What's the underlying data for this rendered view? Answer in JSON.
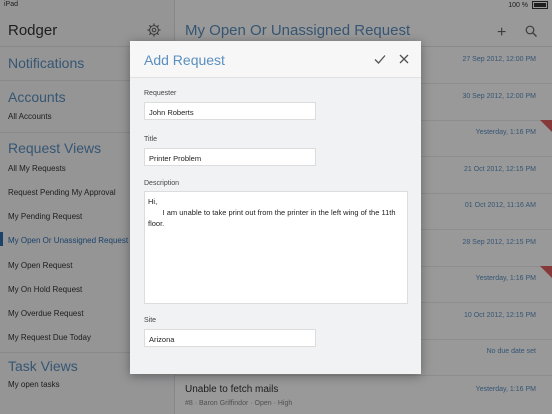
{
  "status_bar": {
    "device": "iPad",
    "battery": "100 %"
  },
  "sidebar": {
    "user_name": "Rodger",
    "notifications": "Notifications",
    "accounts": {
      "title": "Accounts",
      "items": [
        "All Accounts"
      ]
    },
    "request_views": {
      "title": "Request Views",
      "items": [
        "All My Requests",
        "Request Pending My Approval",
        "My Pending Request",
        "My Open Or Unassigned Request",
        "My Open Request",
        "My On Hold Request",
        "My Overdue Request",
        "My Request Due Today"
      ],
      "active": "My Open Or Unassigned Request"
    },
    "task_views": {
      "title": "Task Views",
      "items": [
        "My open tasks"
      ]
    }
  },
  "main": {
    "title": "My Open Or Unassigned Request",
    "rows": [
      {
        "date": "27 Sep 2012, 12:00 PM",
        "flag": false
      },
      {
        "date": "30 Sep 2012, 12:00 PM",
        "flag": false
      },
      {
        "date": "Yesterday, 1:16 PM",
        "flag": true
      },
      {
        "date": "21 Oct 2012, 12:15 PM",
        "flag": false
      },
      {
        "date": "01 Oct 2012, 11:16 AM",
        "flag": false
      },
      {
        "date": "28 Sep 2012, 12:15 PM",
        "flag": false
      },
      {
        "date": "Yesterday, 1:16 PM",
        "flag": true
      },
      {
        "date": "10 Oct 2012, 12:15 PM",
        "flag": false
      },
      {
        "date": "No due date set",
        "flag": false
      }
    ],
    "last_row": {
      "title": "Unable to fetch mails",
      "meta": "#8  ·  Baron Griffindor  ·  Open  ·  High",
      "date": "Yesterday, 1:16 PM"
    }
  },
  "modal": {
    "title": "Add Request",
    "fields": {
      "requester": {
        "label": "Requester",
        "value": "John Roberts"
      },
      "title": {
        "label": "Title",
        "value": "Printer Problem"
      },
      "description": {
        "label": "Description",
        "value": "Hi,\n       I am unable to take print out from the printer in the left wing of the 11th floor."
      },
      "site": {
        "label": "Site",
        "value": "Arizona"
      }
    }
  },
  "colors": {
    "accent": "#5a8fc0",
    "flag": "#e06060"
  }
}
